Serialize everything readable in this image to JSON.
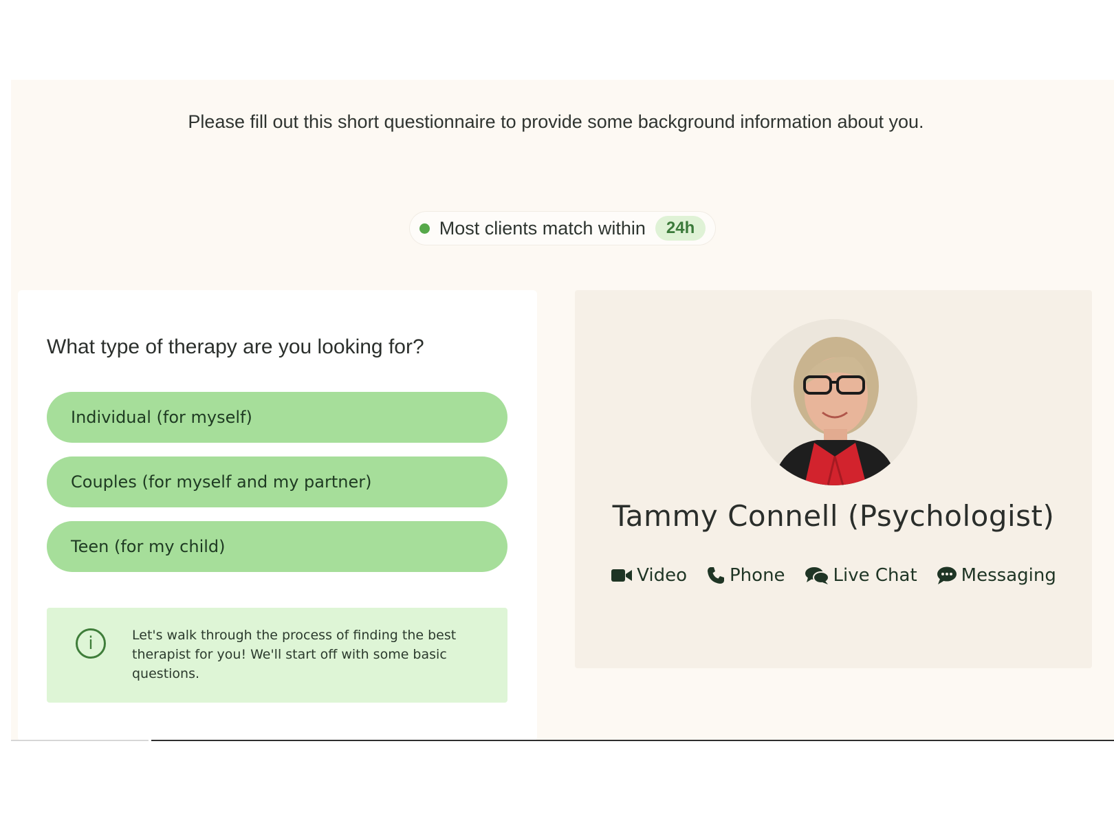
{
  "intro": {
    "text": "Please fill out this short questionnaire to provide some background information about you."
  },
  "match_pill": {
    "text": "Most clients match within",
    "badge": "24h"
  },
  "question": {
    "title": "What type of therapy are you looking for?",
    "options": [
      "Individual (for myself)",
      "Couples (for myself and my partner)",
      "Teen (for my child)"
    ]
  },
  "info": {
    "text": "Let's walk through the process of finding the best therapist for you! We'll start off with some basic questions."
  },
  "therapist": {
    "name": "Tammy Connell (Psychologist)",
    "modes": [
      {
        "label": "Video",
        "icon": "video-camera-icon"
      },
      {
        "label": "Phone",
        "icon": "phone-icon"
      },
      {
        "label": "Live Chat",
        "icon": "chat-bubbles-icon"
      },
      {
        "label": "Messaging",
        "icon": "message-bubble-icon"
      }
    ]
  },
  "colors": {
    "option_bg": "#a6de9a",
    "info_bg": "#def5d6",
    "page_bg": "#fdf9f3",
    "card_right_bg": "#f6f0e7",
    "accent_green": "#56a84a"
  }
}
